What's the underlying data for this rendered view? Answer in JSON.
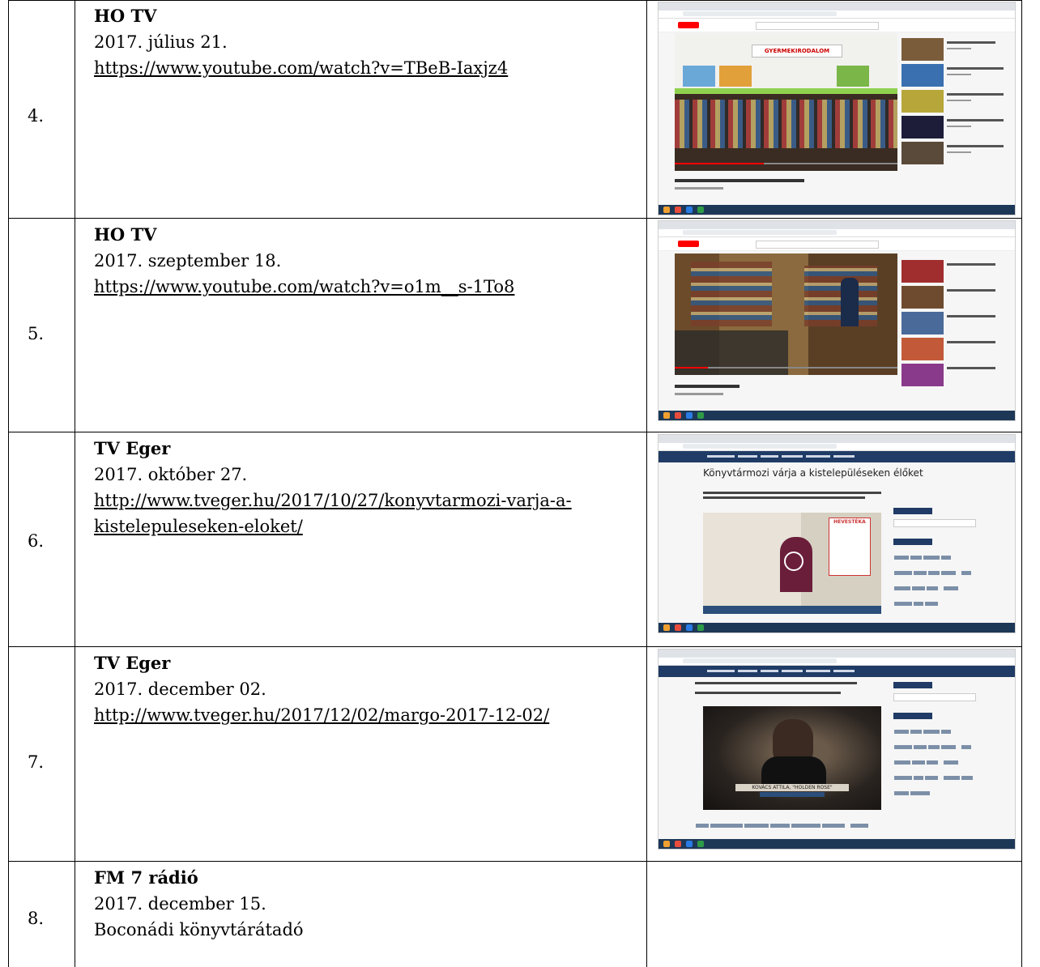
{
  "rows": [
    {
      "num": "4.",
      "title": "HO TV",
      "date": "2017. július 21.",
      "link": "https://www.youtube.com/watch?v=TBeB-Iaxjz4",
      "shot": {
        "site": "youtube",
        "banner": "GYERMEKIRODALOM"
      }
    },
    {
      "num": "5.",
      "title": "HO TV",
      "date": "2017. szeptember 18.",
      "link": "https://www.youtube.com/watch?v=o1m__s-1To8",
      "shot": {
        "site": "youtube"
      }
    },
    {
      "num": "6.",
      "title": "TV Eger",
      "date": "2017. október 27.",
      "link": "http://www.tveger.hu/2017/10/27/konyvtarmozi-varja-a-kistelepuleseken-eloket/",
      "shot": {
        "site": "tveger",
        "headline": "Könyvtármozi várja a kistelepüléseken élőket",
        "banner": "HEVESTÉKA"
      }
    },
    {
      "num": "7.",
      "title": "TV Eger",
      "date": "2017. december 02.",
      "link": "http://www.tveger.hu/2017/12/02/margo-2017-12-02/",
      "shot": {
        "site": "tveger",
        "caption": "KOVÁCS ATTILA, \"HOLDEN ROSE\""
      }
    },
    {
      "num": "8.",
      "title": "FM 7 rádió",
      "date": "2017. december 15.",
      "text": "Boconádi könyvtárátadó"
    }
  ],
  "colors": {
    "youtube_red": "#ff0000",
    "tveger_nav": "#1f3b66",
    "taskbar": "#1d3857"
  }
}
